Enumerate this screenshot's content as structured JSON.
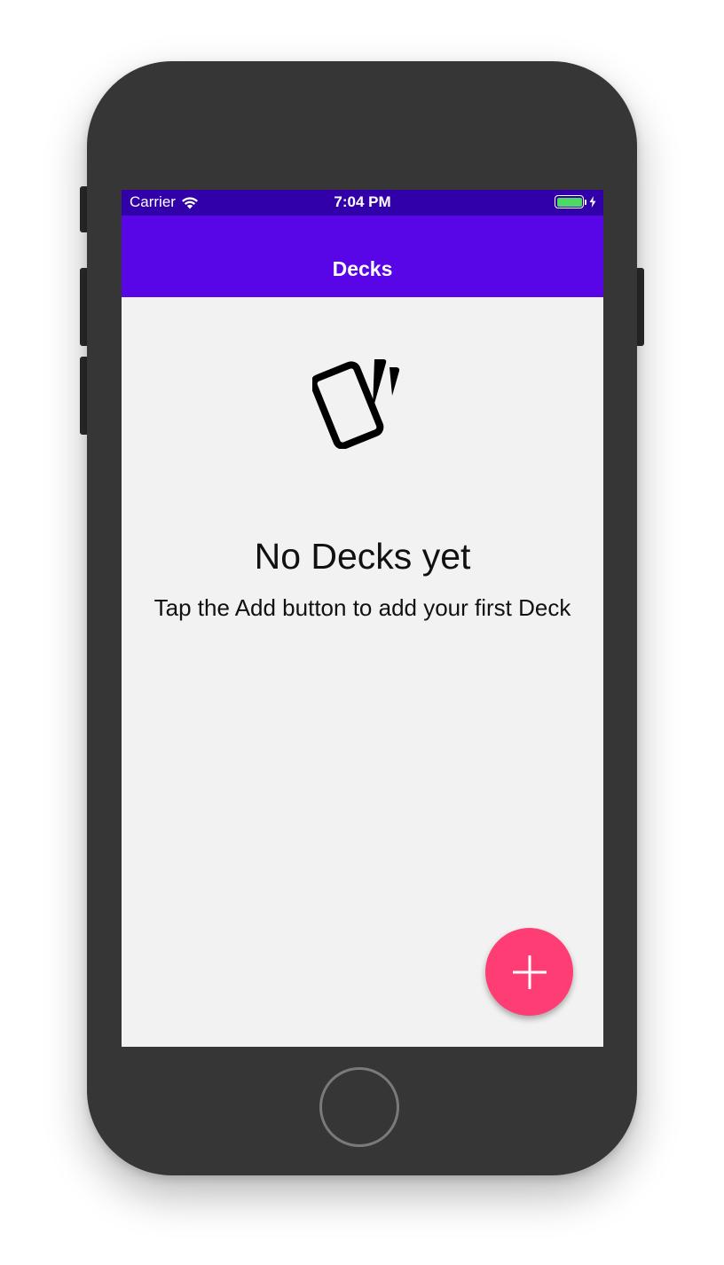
{
  "status_bar": {
    "carrier": "Carrier",
    "time": "7:04 PM",
    "wifi_icon": "wifi-icon",
    "battery_icon": "battery-icon",
    "charging_icon": "charging-bolt-icon",
    "battery_level": 1.0
  },
  "nav_bar": {
    "title": "Decks"
  },
  "empty_state": {
    "icon": "cards-icon",
    "title": "No Decks yet",
    "subtitle": "Tap the Add button to add your first Deck"
  },
  "fab": {
    "icon": "plus-icon"
  },
  "colors": {
    "status_bar_bg": "#3200a8",
    "nav_bar_bg": "#5805e8",
    "screen_bg": "#f2f2f2",
    "fab_bg": "#fd3d74",
    "phone_body": "#363636",
    "battery_fill": "#4cd964"
  }
}
